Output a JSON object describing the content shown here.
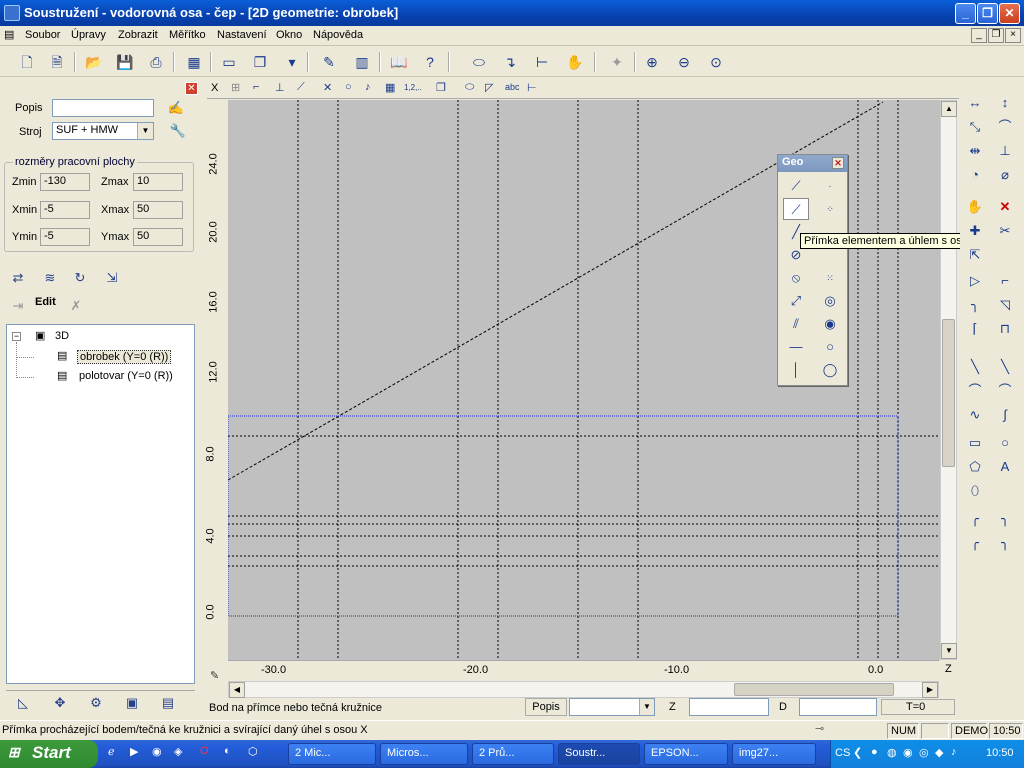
{
  "window": {
    "title": "Soustružení - vodorovná osa - čep - [2D geometrie: obrobek]",
    "controls": [
      "_",
      "❐",
      "✕"
    ]
  },
  "menu": {
    "items": [
      "Soubor",
      "Úpravy",
      "Zobrazit",
      "Měřítko",
      "Nastavení",
      "Okno",
      "Nápověda"
    ],
    "mdi_controls": [
      "_",
      "❐",
      "×"
    ]
  },
  "left_panel": {
    "popis_label": "Popis",
    "popis_value": "",
    "stroj_label": "Stroj",
    "stroj_value": "SUF + HMW",
    "group_caption": "rozměry pracovní plochy",
    "zmin_label": "Zmin",
    "zmin_value": "-130",
    "zmax_label": "Zmax",
    "zmax_value": "10",
    "xmin_label": "Xmin",
    "xmin_value": "-5",
    "xmax_label": "Xmax",
    "xmax_value": "50",
    "ymin_label": "Ymin",
    "ymin_value": "-5",
    "ymax_label": "Ymax",
    "ymax_value": "50",
    "edit_label": "Edit",
    "tree": {
      "root": "3D",
      "children": [
        "obrobek (Y=0 (R))",
        "polotovar (Y=0 (R))"
      ]
    }
  },
  "canvas": {
    "y_ticks": [
      "24.0",
      "20.0",
      "16.0",
      "12.0",
      "8.0",
      "4.0",
      "0.0"
    ],
    "x_ticks": [
      "-30.0",
      "-20.0",
      "-10.0",
      "0.0"
    ],
    "z_axis_label": "Z",
    "toolbar_x_label": "X",
    "toolbar_text_label": "1,2,.."
  },
  "geo_palette": {
    "title": "Geo"
  },
  "tooltip": "Přímka elementem a úhlem s osou X",
  "canvas_status": {
    "message": "Bod na přímce nebo tečná  kružnice",
    "popis_label": "Popis",
    "z_label": "Z",
    "d_label": "D",
    "t_label": "T=0"
  },
  "statusbar": {
    "message": "Přímka procházející bodem/tečná ke kružnici a svírající daný úhel s osou X",
    "num": "NUM",
    "demo": "DEMO",
    "time": "10:50"
  },
  "taskbar": {
    "start": "Start",
    "tasks": [
      "2 Mic...",
      "Micros...",
      "2 Prů...",
      "Soustr...",
      "EPSON...",
      "img27..."
    ],
    "tray_cs": "CS",
    "clock": "10:50"
  }
}
